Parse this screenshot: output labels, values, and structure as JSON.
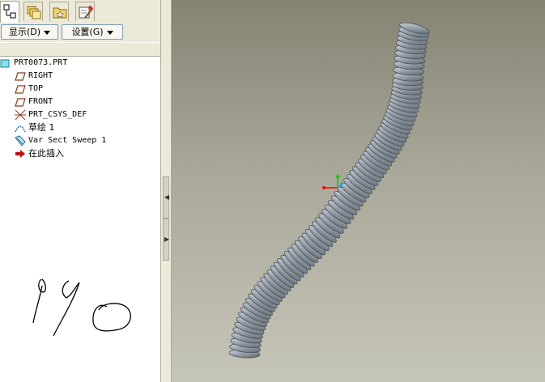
{
  "tabs": [
    {
      "name": "model-tree-tab",
      "icon": "model-tree-icon",
      "active": true
    },
    {
      "name": "folder-browser-tab",
      "icon": "folder-layers-icon",
      "active": false
    },
    {
      "name": "favorites-tab",
      "icon": "favorites-folder-icon",
      "active": false
    },
    {
      "name": "tools-tab",
      "icon": "hammer-tools-icon",
      "active": false
    }
  ],
  "toolbar": {
    "show_label": "显示(D)",
    "settings_label": "设置(G)"
  },
  "tree": {
    "root": "PRT0073.PRT",
    "items": [
      {
        "label": "RIGHT",
        "icon": "datum-plane-icon"
      },
      {
        "label": "TOP",
        "icon": "datum-plane-icon"
      },
      {
        "label": "FRONT",
        "icon": "datum-plane-icon"
      },
      {
        "label": "PRT_CSYS_DEF",
        "icon": "coordinate-system-icon"
      },
      {
        "label": "草绘 1",
        "icon": "sketch-icon"
      },
      {
        "label": "Var Sect Sweep 1",
        "icon": "var-sect-sweep-icon"
      },
      {
        "label": "在此插入",
        "icon": "insert-here-arrow-icon"
      }
    ]
  },
  "handwriting_icon": "handwritten-scribble-icon",
  "colors": {
    "panel_bg": "#ece9d8",
    "viewport_top": "#858473",
    "viewport_bottom": "#c6c5b9",
    "model": "#8f98a3",
    "axis_x": "#ff0000",
    "axis_y": "#00cc00",
    "axis_z": "#00aaff"
  },
  "model_icon": "corrugated-tube-model-icon",
  "csys_icon": "csys-triad-icon"
}
